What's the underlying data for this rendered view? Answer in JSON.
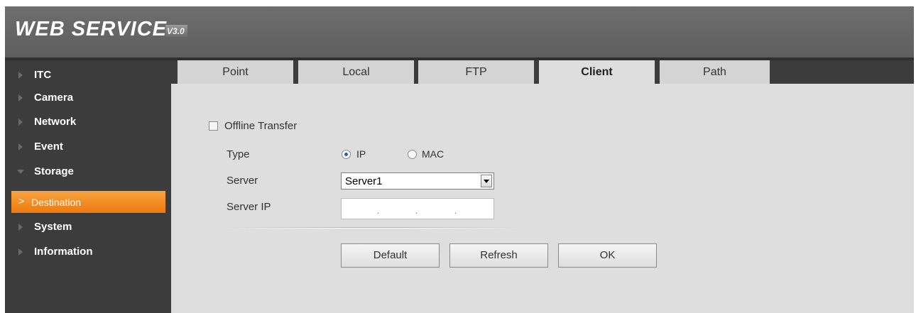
{
  "header": {
    "logo_text": "WEB  SERVICE",
    "version": "V3.0"
  },
  "sidebar": {
    "items": [
      {
        "label": "ITC",
        "expanded": false
      },
      {
        "label": "Camera",
        "expanded": false
      },
      {
        "label": "Network",
        "expanded": false
      },
      {
        "label": "Event",
        "expanded": false
      },
      {
        "label": "Storage",
        "expanded": true
      },
      {
        "label": "System",
        "expanded": false
      },
      {
        "label": "Information",
        "expanded": false
      }
    ],
    "active_subitem": {
      "label": "Destination",
      "parent": "Storage",
      "selected": true
    }
  },
  "tabs": [
    {
      "label": "Point",
      "active": false
    },
    {
      "label": "Local",
      "active": false
    },
    {
      "label": "FTP",
      "active": false
    },
    {
      "label": "Client",
      "active": true
    },
    {
      "label": "Path",
      "active": false
    }
  ],
  "form": {
    "offline_transfer": {
      "label": "Offline Transfer",
      "checked": false
    },
    "type": {
      "label": "Type",
      "options": [
        "IP",
        "MAC"
      ],
      "selected": "IP"
    },
    "server": {
      "label": "Server",
      "value": "Server1"
    },
    "server_ip": {
      "label": "Server IP",
      "value": " .  .  . "
    }
  },
  "buttons": {
    "default": "Default",
    "refresh": "Refresh",
    "ok": "OK"
  },
  "colors": {
    "accent": "#f39122",
    "sidebar_bg": "#3c3c3c",
    "content_bg": "#dedede",
    "radio_selected": "#2a5bb5"
  }
}
